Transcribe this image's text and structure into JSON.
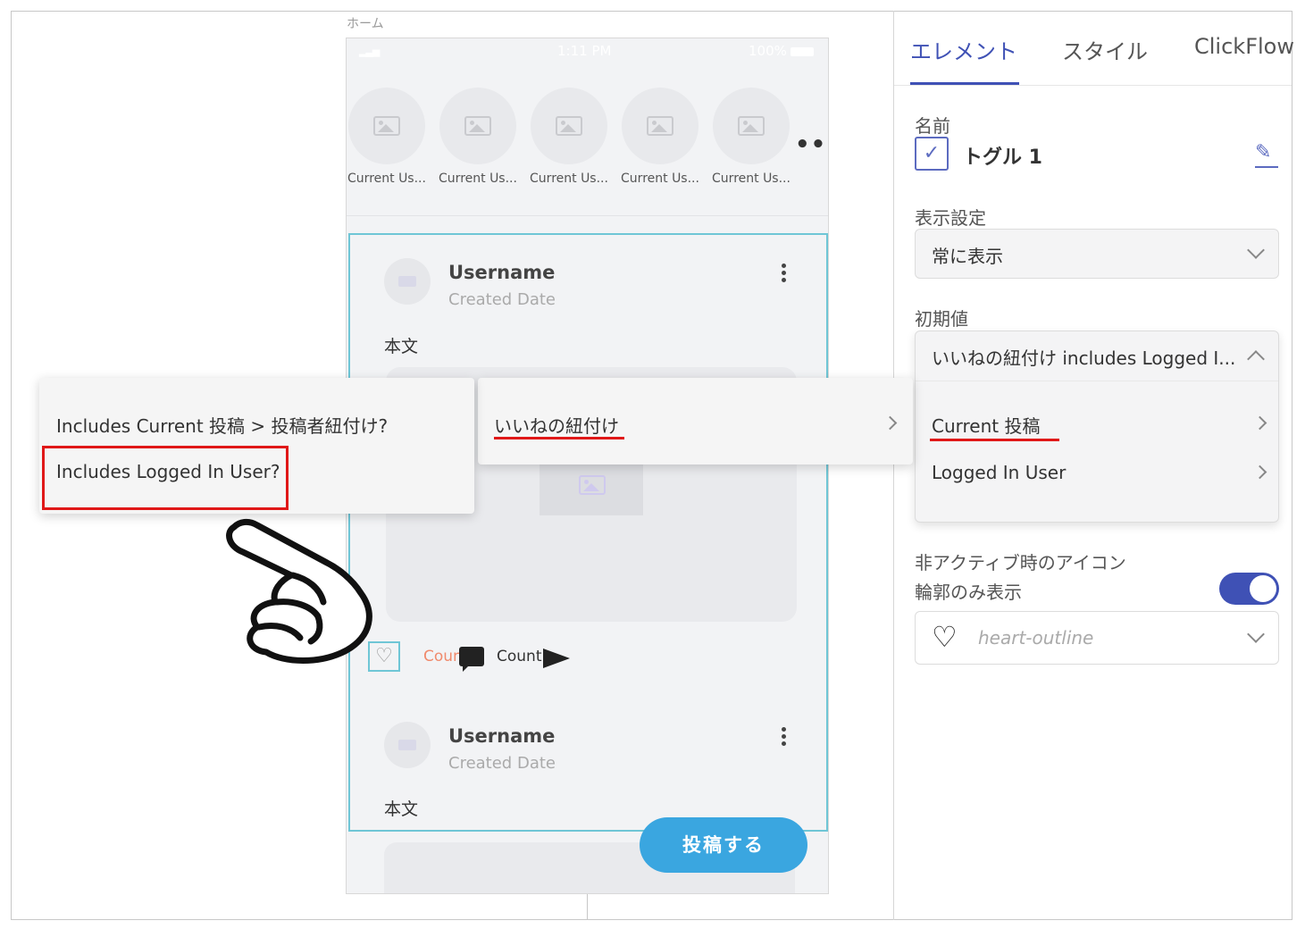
{
  "canvas": {
    "screen_label": "ホーム"
  },
  "phone": {
    "status": {
      "time": "1:11 PM",
      "battery": "100%"
    },
    "stories": [
      {
        "label": "Current Us..."
      },
      {
        "label": "Current Us..."
      },
      {
        "label": "Current Us..."
      },
      {
        "label": "Current Us..."
      },
      {
        "label": "Current Us..."
      }
    ],
    "more": "•••",
    "posts": [
      {
        "username": "Username",
        "date": "Created Date",
        "body": "本文"
      },
      {
        "username": "Username",
        "date": "Created Date",
        "body": "本文"
      }
    ],
    "actions": {
      "like_count": "Count",
      "comment_count": "Count"
    },
    "post_button": "投稿する"
  },
  "panel": {
    "tabs": [
      {
        "label": "エレメント",
        "active": true
      },
      {
        "label": "スタイル",
        "active": false
      },
      {
        "label": "ClickFlow",
        "active": false
      }
    ],
    "name_label": "名前",
    "element_name": "トグル 1",
    "visibility_label": "表示設定",
    "visibility_value": "常に表示",
    "initial_label": "初期値",
    "initial_value": "いいねの紐付け includes Logged I...",
    "initial_options": [
      {
        "label": "Current 投稿"
      },
      {
        "label": "Logged In User"
      }
    ],
    "inactive_icon_label": "非アクティブ時のアイコン",
    "outline_label": "輪郭のみ表示",
    "outline_on": true,
    "icon_value": "heart-outline"
  },
  "menus": {
    "level1": [
      {
        "label": "Includes Current 投稿 > 投稿者紐付け?"
      },
      {
        "label": "Includes Logged In User?"
      }
    ],
    "level2": [
      {
        "label": "いいねの紐付け"
      }
    ]
  },
  "colors": {
    "accent": "#3f51b5",
    "highlight": "#e01818",
    "selection": "#6fc6d6",
    "fab": "#3aa6e0"
  }
}
